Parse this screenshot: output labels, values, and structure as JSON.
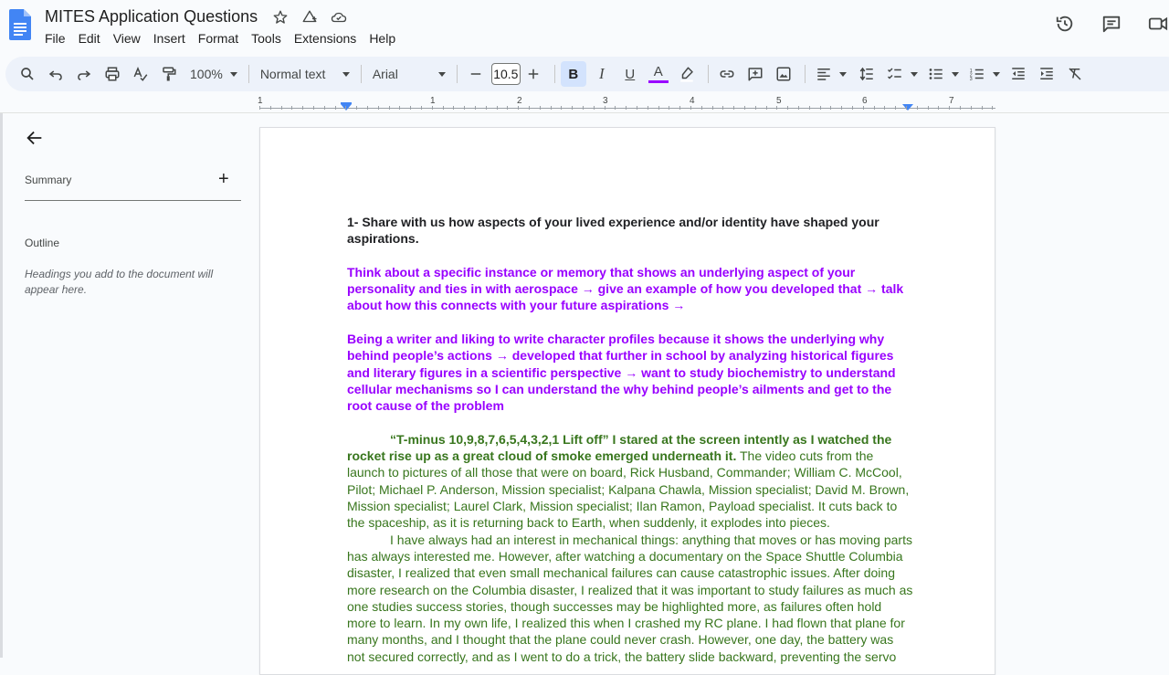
{
  "app": {
    "title": "MITES Application Questions",
    "menu": [
      "File",
      "Edit",
      "View",
      "Insert",
      "Format",
      "Tools",
      "Extensions",
      "Help"
    ]
  },
  "toolbar": {
    "zoom": "100%",
    "style": "Normal text",
    "font": "Arial",
    "font_size": "10.5",
    "text_color": "#9900ff"
  },
  "ruler": {
    "labels": [
      "1",
      "1",
      "2",
      "3",
      "4",
      "5",
      "6",
      "7"
    ]
  },
  "outline": {
    "summary_label": "Summary",
    "add_symbol": "+",
    "outline_label": "Outline",
    "hint": "Headings you add to the document will appear here."
  },
  "document": {
    "question": "1- Share with us how aspects of your lived experience and/or identity have shaped your aspirations.",
    "note1": "Think about a specific instance or memory that shows an underlying aspect of your personality and ties in with aerospace → give an example of how you developed that → talk about how this connects with your future aspirations →",
    "note2": "Being a writer and liking to write character profiles because it shows the underlying why behind people’s actions → developed that further in school by analyzing historical figures and literary figures in a scientific perspective → want to study biochemistry to understand cellular mechanisms so I can understand the why behind people’s ailments and get to the root cause of the problem",
    "essay_p1_bold": "“T-minus 10,9,8,7,6,5,4,3,2,1 Lift off” I stared at the screen intently as I watched the rocket rise up as a great cloud of smoke emerged underneath it.",
    "essay_p1_rest": " The video cuts from the launch to pictures of all those that were on board, Rick Husband, Commander; William C. McCool, Pilot; Michael P. Anderson, Mission specialist; Kalpana Chawla, Mission specialist; David M. Brown, Mission specialist; Laurel Clark, Mission specialist; Ilan Ramon, Payload specialist. It cuts back to the spaceship, as it is returning back to Earth, when suddenly, it explodes into pieces.",
    "essay_p2": "I have always had an interest in mechanical things: anything that moves or has moving parts has always interested me. However, after watching a documentary on the Space Shuttle Columbia disaster, I realized that even small mechanical failures can cause catastrophic issues. After doing more research on the Columbia disaster, I realized that it was important to study failures as much as one studies success stories, though successes may be highlighted more, as failures often hold more to learn. In my own life, I realized this when I crashed my RC plane. I had flown that plane for many months, and I thought that the plane could never crash. However, one day, the battery was not secured correctly, and as I went to do a trick, the battery slide backward, preventing the servo"
  },
  "colors": {
    "accent": "#1a73e8",
    "purple_text": "#9900ff",
    "green_text": "#38761d",
    "toolbar_bg": "#edf2fa"
  }
}
